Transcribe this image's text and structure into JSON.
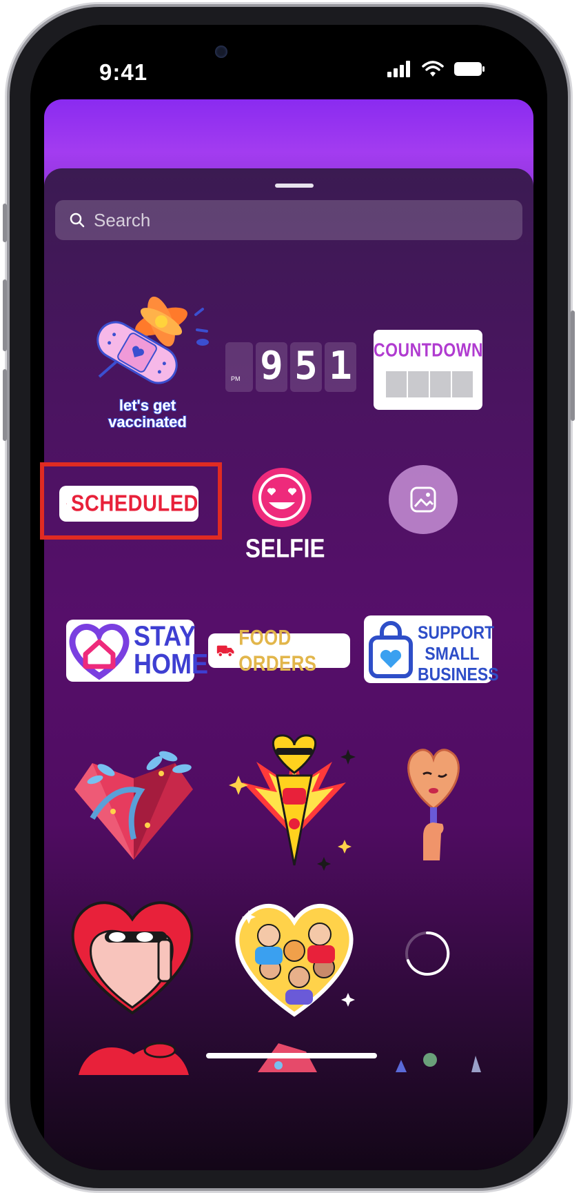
{
  "status_bar": {
    "time": "9:41",
    "icons": [
      "signal-icon",
      "wifi-icon",
      "battery-icon"
    ]
  },
  "search": {
    "placeholder": "Search"
  },
  "stickers": {
    "row1": {
      "vaccinated": {
        "label": "let's get vaccinated"
      },
      "time_sticker": {
        "meridiem": "PM",
        "digits": [
          "9",
          "5",
          "1"
        ]
      },
      "countdown": {
        "label": "COUNTDOWN"
      }
    },
    "row2": {
      "scheduled": {
        "label": "SCHEDULED",
        "highlighted": true
      },
      "selfie": {
        "label": "SELFIE"
      },
      "photo": {
        "icon": "photo-icon"
      }
    },
    "row3": {
      "stay_home": {
        "line1": "STAY",
        "line2": "HOME"
      },
      "food_orders": {
        "label": "FOOD ORDERS"
      },
      "support_small_business": {
        "line1": "SUPPORT",
        "line2": "SMALL",
        "line3": "BUSINESS"
      }
    },
    "row4": [
      "gem-heart-sticker",
      "heart-face-totem-sticker",
      "heart-mirror-sticker"
    ],
    "row5": [
      "sunglasses-heart-sticker",
      "family-heart-sticker",
      "loading-spinner"
    ]
  },
  "colors": {
    "highlight": "#e02b22",
    "sheet_top": "#3b1b52",
    "header_gradient": "#8a2bf0",
    "scheduled_red": "#e8213a",
    "countdown_purple": "#b03bd0",
    "stay_home_blue": "#3e3fd2"
  }
}
